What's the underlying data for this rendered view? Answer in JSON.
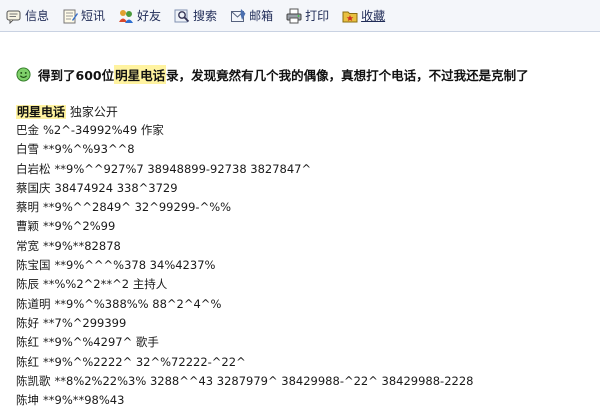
{
  "toolbar": {
    "items": [
      {
        "label": "信息",
        "icon": "message-icon"
      },
      {
        "label": "短讯",
        "icon": "notepad-icon"
      },
      {
        "label": "好友",
        "icon": "friends-icon"
      },
      {
        "label": "搜索",
        "icon": "search-icon"
      },
      {
        "label": "邮箱",
        "icon": "mailbox-icon"
      },
      {
        "label": "打印",
        "icon": "printer-icon"
      },
      {
        "label": "收藏",
        "icon": "bookmark-icon"
      }
    ]
  },
  "post": {
    "headline_before": "得到了600位",
    "headline_highlight": "明星电话",
    "headline_after": "录，发现竟然有几个我的偶像，真想打个电话，不过我还是克制了",
    "section_title_highlight": "明星电话",
    "section_title_rest": "独家公开",
    "entries": [
      {
        "name": "巴金",
        "info": "%2^-34992%49 作家"
      },
      {
        "name": "白雪",
        "info": "**9%^%93^^8"
      },
      {
        "name": "白岩松",
        "info": "**9%^^927%7 38948899-92738 3827847^"
      },
      {
        "name": "蔡国庆",
        "info": "38474924 338^3729"
      },
      {
        "name": "蔡明",
        "info": "**9%^^2849^ 32^99299-^%%"
      },
      {
        "name": "曹颖",
        "info": "**9%^2%99"
      },
      {
        "name": "常宽",
        "info": "**9%**82878"
      },
      {
        "name": "陈宝国",
        "info": "**9%^^^%378 34%4237%"
      },
      {
        "name": "陈辰",
        "info": "**%%2^2**^2 主持人"
      },
      {
        "name": "陈道明",
        "info": "**9%^%388%% 88^2^4^%"
      },
      {
        "name": "陈好",
        "info": "**7%^299399"
      },
      {
        "name": "陈红",
        "info": "**9%^%4297^ 歌手"
      },
      {
        "name": "陈红",
        "info": "**9%^%2222^ 32^%72222-^22^"
      },
      {
        "name": "陈凯歌",
        "info": "**8%2%22%3% 3288^^43 3287979^ 38429988-^22^ 38429988-2228"
      },
      {
        "name": "陈坤",
        "info": "**9%**98%43"
      }
    ]
  },
  "colors": {
    "highlight": "#fff3a0",
    "toolbar_bg": "#f4f6fa",
    "toolbar_text": "#1f2b57"
  }
}
